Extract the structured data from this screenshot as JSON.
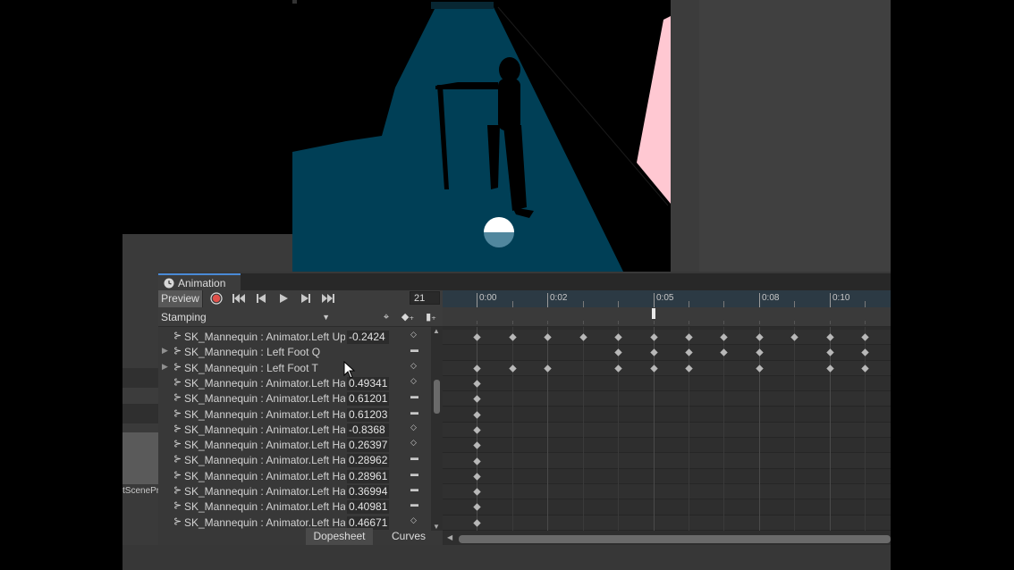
{
  "scene_view": {
    "colors": {
      "floor": "#003f56",
      "background": "#000000",
      "pink": "#ffc8d2"
    }
  },
  "background": {
    "left_truncated_label": "tScenePr"
  },
  "animation_window": {
    "tab_title": "Animation",
    "tab_icon": "clock-icon",
    "toolbar": {
      "preview_label": "Preview",
      "record_icon": "record-icon",
      "first_key_icon": "first-keyframe-icon",
      "prev_key_icon": "previous-keyframe-icon",
      "play_icon": "play-icon",
      "next_key_icon": "next-keyframe-icon",
      "last_key_icon": "last-keyframe-icon",
      "frame": "21"
    },
    "clip_dropdown": "Stamping",
    "row2_icons": {
      "filter": "crosshair-icon",
      "add_key": "add-keyframe-icon",
      "add_event": "add-event-icon"
    },
    "timeline_labels": [
      "0:00",
      "0:02",
      "0:05",
      "0:08",
      "0:10"
    ],
    "properties": [
      {
        "name": "SK_Mannequin : Animator.Left Up",
        "value": "-0.2424",
        "expandable": false,
        "key_icon": "diamond"
      },
      {
        "name": "SK_Mannequin : Left Foot Q",
        "value": "",
        "expandable": true,
        "key_icon": "dash"
      },
      {
        "name": "SK_Mannequin : Left Foot T",
        "value": "",
        "expandable": true,
        "key_icon": "diamond"
      },
      {
        "name": "SK_Mannequin : Animator.Left Ha",
        "value": "0.49341",
        "expandable": false,
        "key_icon": "diamond"
      },
      {
        "name": "SK_Mannequin : Animator.Left Ha",
        "value": "0.61201",
        "expandable": false,
        "key_icon": "dash"
      },
      {
        "name": "SK_Mannequin : Animator.Left Ha",
        "value": "0.61203",
        "expandable": false,
        "key_icon": "dash"
      },
      {
        "name": "SK_Mannequin : Animator.Left Ha",
        "value": "-0.8368",
        "expandable": false,
        "key_icon": "diamond"
      },
      {
        "name": "SK_Mannequin : Animator.Left Ha",
        "value": "0.26397",
        "expandable": false,
        "key_icon": "diamond"
      },
      {
        "name": "SK_Mannequin : Animator.Left Ha",
        "value": "0.28962",
        "expandable": false,
        "key_icon": "dash"
      },
      {
        "name": "SK_Mannequin : Animator.Left Ha",
        "value": "0.28961",
        "expandable": false,
        "key_icon": "dash"
      },
      {
        "name": "SK_Mannequin : Animator.Left Ha",
        "value": "0.36994",
        "expandable": false,
        "key_icon": "dash"
      },
      {
        "name": "SK_Mannequin : Animator.Left Ha",
        "value": "0.40981",
        "expandable": false,
        "key_icon": "dash"
      },
      {
        "name": "SK_Mannequin : Animator.Left Ha",
        "value": "0.46671",
        "expandable": false,
        "key_icon": "diamond"
      }
    ],
    "bottom_tabs": {
      "dopesheet": "Dopesheet",
      "curves": "Curves"
    },
    "keyframe_rows": [
      [
        0,
        1,
        2,
        3,
        4,
        5,
        6,
        7,
        8,
        9,
        10,
        11
      ],
      [
        4,
        5,
        6,
        7,
        8,
        10,
        11
      ],
      [
        0,
        1,
        2,
        4,
        5,
        6,
        8,
        10,
        11
      ],
      [
        0
      ],
      [
        0
      ],
      [
        0
      ],
      [
        0
      ],
      [
        0
      ],
      [
        0
      ],
      [
        0
      ],
      [
        0
      ],
      [
        0
      ],
      [
        0
      ]
    ]
  }
}
